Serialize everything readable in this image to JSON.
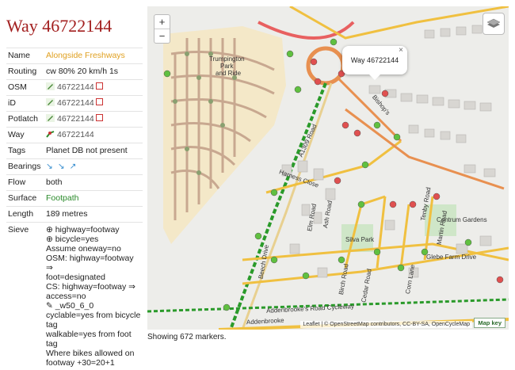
{
  "title": "Way 46722144",
  "props": {
    "name_label": "Name",
    "name_value": "Alongside Freshways",
    "routing_label": "Routing",
    "routing_value": "cw 80% 20 km/h 1s",
    "osm_label": "OSM",
    "osm_value": "46722144",
    "id_label": "iD",
    "id_value": "46722144",
    "potlatch_label": "Potlatch",
    "potlatch_value": "46722144",
    "way_label": "Way",
    "way_value": "46722144",
    "tags_label": "Tags",
    "tags_value": "Planet DB not present",
    "bearings_label": "Bearings",
    "flow_label": "Flow",
    "flow_value": "both",
    "surface_label": "Surface",
    "surface_value": "Footpath",
    "length_label": "Length",
    "length_value": "189 metres",
    "sieve_label": "Sieve",
    "sieve_lines": [
      "⊕ highway=footway",
      "⊕ bicycle=yes",
      "Assume oneway=no",
      "OSM: highway=footway ⇒",
      "foot=designated",
      "CS: highway=footway ⇒",
      "access=no",
      "✎ _w50_6_0",
      "cyclable=yes from bicycle",
      "tag",
      "walkable=yes from foot tag",
      "Where bikes allowed on",
      "footway +30=20+1"
    ]
  },
  "map": {
    "zoom_in": "+",
    "zoom_out": "−",
    "popup_text": "Way 46722144",
    "popup_close": "×",
    "attribution": "Leaflet | © OpenStreetMap contributors, CC-BY-SA, OpenCycleMap",
    "map_key": "Map key",
    "labels": {
      "trumpington": "Trumpington",
      "park": "Park",
      "and_ride": "and Ride",
      "harness_close": "Harness Close",
      "elm_road": "Elm Road",
      "ash_road": "Ash Road",
      "beech_drive": "Beech Drive",
      "birch_road": "Birch Road",
      "cedar_road": "Cedar Road",
      "corn_lane": "Corn Lane",
      "glebe_farm_drive": "Glebe Farm Drive",
      "centrum_gardens": "Centrum Gardens",
      "silva_park": "Silva Park",
      "addenbrookes_road": "Addenbrooke's Road Cycleway",
      "addenbrookes": "Addenbrooke",
      "bishops": "Bishop's",
      "a1309": "A1309 Road",
      "martin_road": "Martin Road",
      "tenby_road": "Tenby Road"
    }
  },
  "status": "Showing 672 markers.",
  "colors": {
    "title": "#a32020",
    "name": "#e0a020",
    "surface": "#2a8a2a"
  }
}
